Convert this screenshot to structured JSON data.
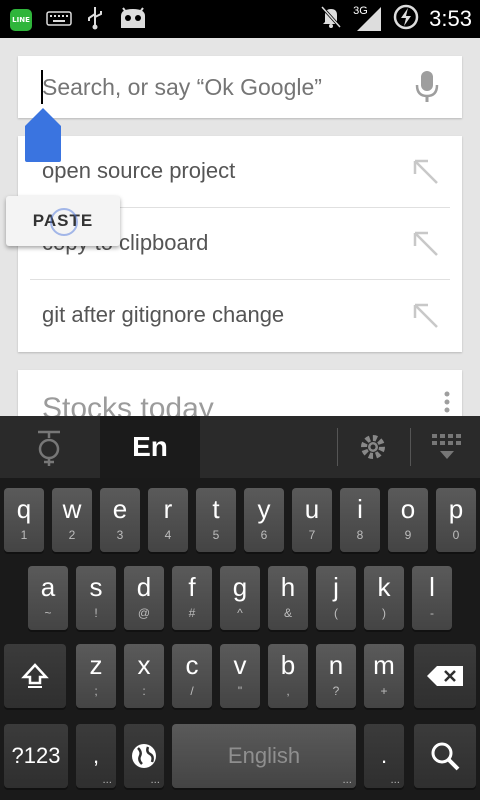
{
  "status_bar": {
    "line_icon_text": "LINE",
    "network": "3G",
    "time": "3:53",
    "icons": [
      "line-icon",
      "keyboard-icon",
      "usb-icon",
      "android-debug-icon",
      "mute-icon",
      "signal-icon",
      "no-battery-charging-icon"
    ]
  },
  "search": {
    "placeholder": "Search, or say “Ok Google”",
    "mic_icon": "mic-icon"
  },
  "suggestions": [
    {
      "label": "open source project"
    },
    {
      "label": "copy to clipboard"
    },
    {
      "label": "git after gitignore change"
    }
  ],
  "paste_popup": {
    "label": "PASTE"
  },
  "stocks_card": {
    "title": "Stocks today"
  },
  "keyboard": {
    "language_tab": "En",
    "rows": [
      [
        {
          "k": "q",
          "s": "1"
        },
        {
          "k": "w",
          "s": "2"
        },
        {
          "k": "e",
          "s": "3"
        },
        {
          "k": "r",
          "s": "4"
        },
        {
          "k": "t",
          "s": "5"
        },
        {
          "k": "y",
          "s": "6"
        },
        {
          "k": "u",
          "s": "7"
        },
        {
          "k": "i",
          "s": "8"
        },
        {
          "k": "o",
          "s": "9"
        },
        {
          "k": "p",
          "s": "0"
        }
      ],
      [
        {
          "k": "a",
          "s": "~"
        },
        {
          "k": "s",
          "s": "!"
        },
        {
          "k": "d",
          "s": "@"
        },
        {
          "k": "f",
          "s": "#"
        },
        {
          "k": "g",
          "s": "^"
        },
        {
          "k": "h",
          "s": "&"
        },
        {
          "k": "j",
          "s": "("
        },
        {
          "k": "k",
          "s": ")"
        },
        {
          "k": "l",
          "s": "-"
        }
      ],
      [
        {
          "k": "z",
          "s": ";"
        },
        {
          "k": "x",
          "s": ":"
        },
        {
          "k": "c",
          "s": "/"
        },
        {
          "k": "v",
          "s": "\""
        },
        {
          "k": "b",
          "s": ","
        },
        {
          "k": "n",
          "s": "?"
        },
        {
          "k": "m",
          "s": "+"
        }
      ]
    ],
    "symbols_key": "?123",
    "comma_key": ",",
    "space_key": "English",
    "period_key": ".",
    "key_more_dots": "..."
  },
  "colors": {
    "accent_blue": "#3a74e0",
    "keyboard_bg": "#1a1a1a",
    "card_bg": "#ffffff"
  }
}
